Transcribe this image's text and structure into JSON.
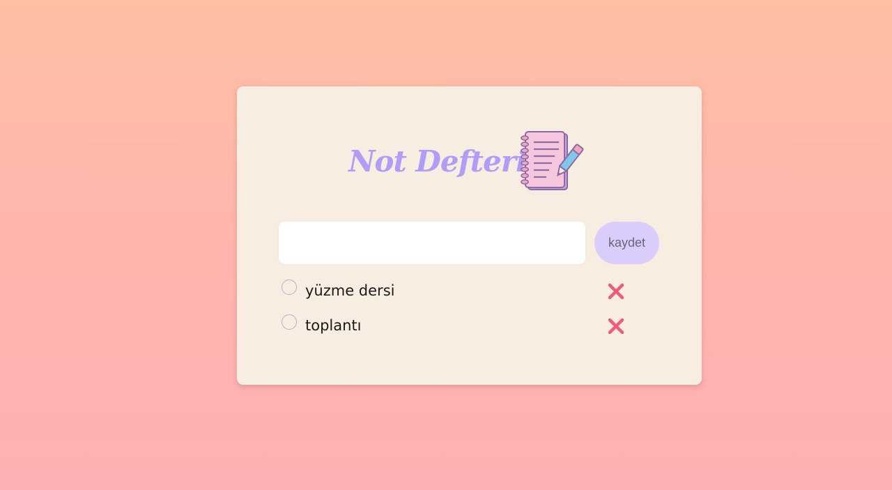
{
  "app": {
    "title": "Not Defteri",
    "icon": "notebook-pen-icon"
  },
  "entry": {
    "value": "",
    "placeholder": "",
    "save_label": "kaydet"
  },
  "todos": [
    {
      "text": "yüzme dersi",
      "done": false,
      "delete_icon": "close-icon"
    },
    {
      "text": "toplantı",
      "done": false,
      "delete_icon": "close-icon"
    }
  ],
  "colors": {
    "accent": "#b09df7",
    "card": "#f7ede0",
    "button": "#dacdfb",
    "delete": "#ef5b7b",
    "checkbox_border": "#c4a5da"
  }
}
